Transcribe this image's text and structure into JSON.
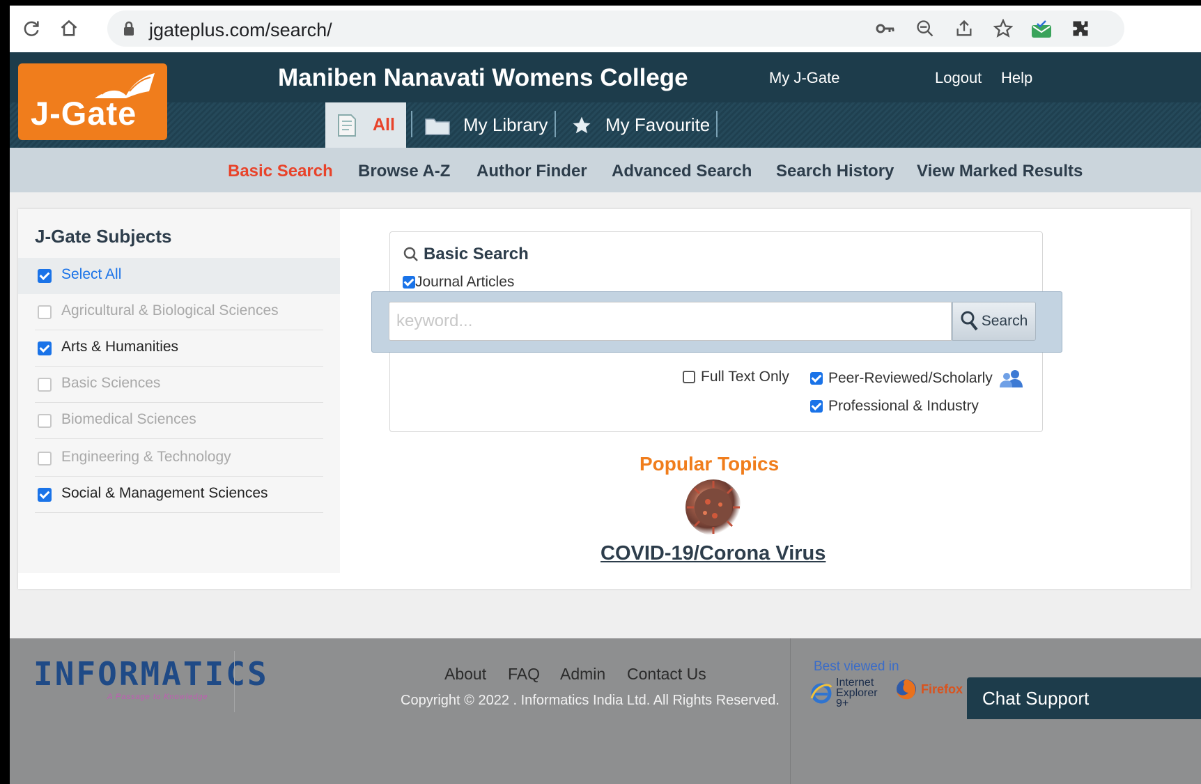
{
  "browser": {
    "url": "jgateplus.com/search/"
  },
  "header": {
    "logo_text": "J-Gate",
    "college": "Maniben Nanavati Womens College",
    "my_jgate": "My J-Gate",
    "logout": "Logout",
    "help": "Help",
    "tabs": [
      {
        "label": "All",
        "icon": "document-icon"
      },
      {
        "label": "My Library",
        "icon": "folder-icon"
      },
      {
        "label": "My Favourite",
        "icon": "star-icon"
      }
    ]
  },
  "subnav": [
    {
      "label": "Basic Search"
    },
    {
      "label": "Browse A-Z"
    },
    {
      "label": "Author Finder"
    },
    {
      "label": "Advanced Search"
    },
    {
      "label": "Search History"
    },
    {
      "label": "View Marked Results"
    }
  ],
  "sidebar": {
    "title": "J-Gate Subjects",
    "items": [
      {
        "label": "Select All",
        "checked": true
      },
      {
        "label": "Agricultural & Biological Sciences",
        "checked": false
      },
      {
        "label": "Arts & Humanities",
        "checked": true
      },
      {
        "label": "Basic Sciences",
        "checked": false
      },
      {
        "label": "Biomedical Sciences",
        "checked": false
      },
      {
        "label": "Engineering & Technology",
        "checked": false
      },
      {
        "label": "Social & Management Sciences",
        "checked": true
      }
    ]
  },
  "search": {
    "title": "Basic Search",
    "journal_articles": "Journal Articles",
    "placeholder": "keyword...",
    "button": "Search",
    "full_text_only": "Full Text Only",
    "peer_reviewed": "Peer-Reviewed/Scholarly",
    "professional": "Professional & Industry"
  },
  "popular": {
    "title": "Popular Topics",
    "topic": "COVID-19/Corona Virus"
  },
  "footer": {
    "brand": "INFORMATICS",
    "tagline": "A Passage to Knowledge",
    "links": [
      "About",
      "FAQ",
      "Admin",
      "Contact Us"
    ],
    "copyright": "Copyright © 2022 . Informatics India Ltd. All Rights Reserved.",
    "best_viewed": "Best viewed in",
    "ie": "Internet Explorer 9+",
    "firefox": "Firefox",
    "chat": "Chat Support"
  },
  "colors": {
    "accent": "#f07d1c",
    "active_link": "#e8432a",
    "header_bg": "#1d3c4b",
    "checkbox": "#1a73e8"
  }
}
